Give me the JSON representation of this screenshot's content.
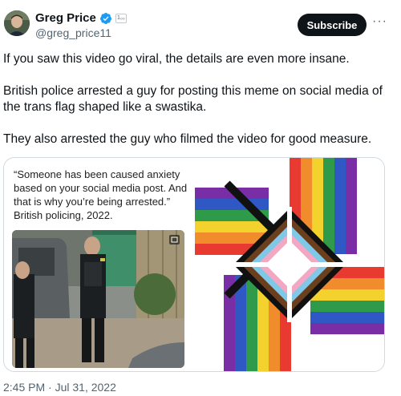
{
  "author": {
    "name": "Greg Price",
    "handle": "@greg_price11",
    "affiliate_badge": "1₀₀"
  },
  "actions": {
    "subscribe_label": "Subscribe",
    "more_label": "···"
  },
  "tweet": {
    "paragraphs": [
      "If you saw this video go viral, the details are even more insane.",
      "British police arrested a guy for posting this meme on social media of the trans flag shaped like a swastika.",
      "They also arrested the guy who filmed the video for good measure."
    ]
  },
  "media": {
    "caption_quote": "“Someone has been caused anxiety based on your social media post. And that is why you’re being arrested.”",
    "caption_attribution": "British policing, 2022."
  },
  "timestamp": "2:45 PM · Jul 31, 2022",
  "colors": {
    "verified": "#1d9bf0",
    "secondary_text": "#536471",
    "subscribe_bg": "#0f1419"
  },
  "icons": [
    "verified-badge-icon",
    "more-options-icon",
    "affiliate-badge-icon"
  ]
}
